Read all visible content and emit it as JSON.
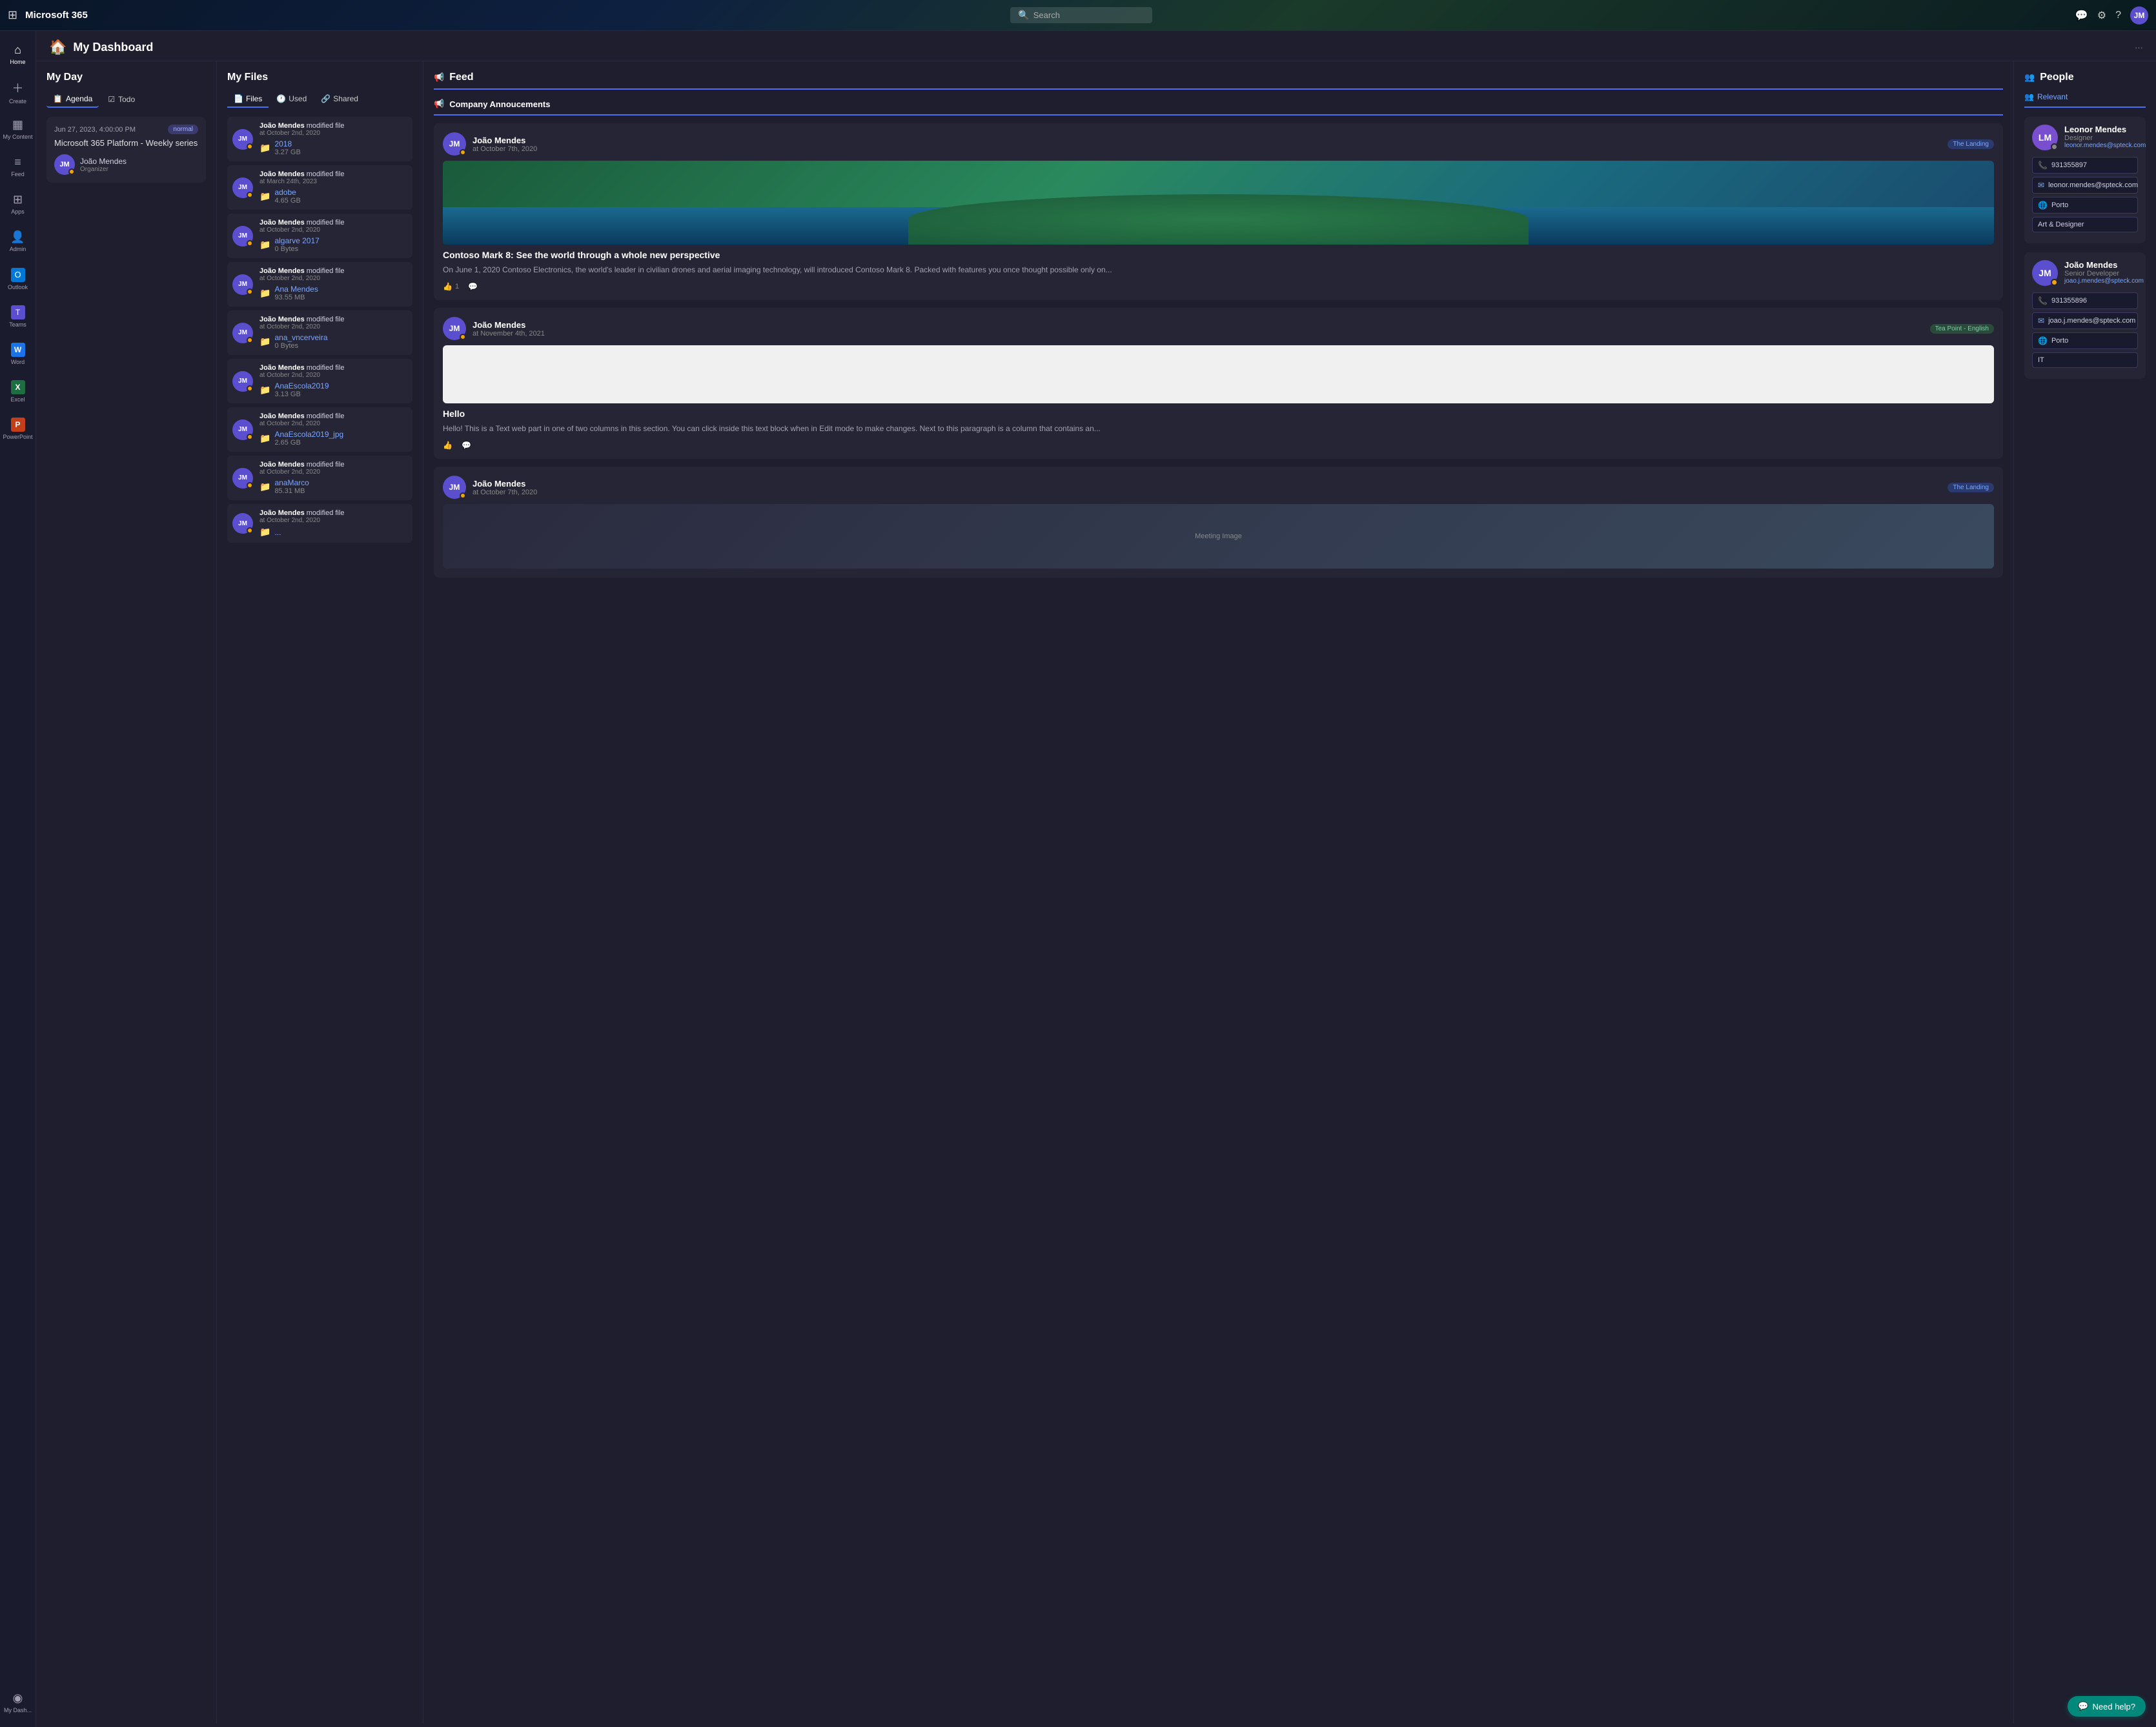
{
  "topbar": {
    "waffle_icon": "⊞",
    "brand": "Microsoft 365",
    "search_placeholder": "Search",
    "search_icon": "🔍"
  },
  "sidebar": {
    "items": [
      {
        "id": "home",
        "icon": "⌂",
        "label": "Home"
      },
      {
        "id": "create",
        "icon": "+",
        "label": "Create"
      },
      {
        "id": "my-content",
        "icon": "▦",
        "label": "My Content"
      },
      {
        "id": "feed",
        "icon": "≡",
        "label": "Feed"
      },
      {
        "id": "apps",
        "icon": "⊞",
        "label": "Apps"
      },
      {
        "id": "admin",
        "icon": "👤",
        "label": "Admin"
      },
      {
        "id": "outlook",
        "icon": "✉",
        "label": "Outlook"
      },
      {
        "id": "teams",
        "icon": "T",
        "label": "Teams"
      },
      {
        "id": "word",
        "icon": "W",
        "label": "Word"
      },
      {
        "id": "excel",
        "icon": "X",
        "label": "Excel"
      },
      {
        "id": "powerpoint",
        "icon": "P",
        "label": "PowerPoint"
      },
      {
        "id": "dashboard",
        "icon": "◉",
        "label": "My Dash..."
      }
    ]
  },
  "page": {
    "icon": "🏠",
    "title": "My Dashboard",
    "more_icon": "···"
  },
  "myday": {
    "title": "My Day",
    "tabs": [
      {
        "id": "agenda",
        "label": "Agenda",
        "icon": "📋",
        "active": true
      },
      {
        "id": "todo",
        "label": "Todo",
        "icon": "☑",
        "active": false
      }
    ],
    "event": {
      "date_time": "Jun 27, 2023, 4:00:00 PM",
      "badge": "normal",
      "title": "Microsoft 365 Platform - Weekly series",
      "organizer_name": "João Mendes",
      "organizer_role": "Organizer"
    }
  },
  "myfiles": {
    "title": "My Files",
    "tabs": [
      {
        "id": "files",
        "label": "Files",
        "icon": "📄",
        "active": true
      },
      {
        "id": "used",
        "label": "Used",
        "icon": "🕐",
        "active": false
      },
      {
        "id": "shared",
        "label": "Shared",
        "icon": "🔗",
        "active": false
      }
    ],
    "items": [
      {
        "person": "João Mendes",
        "action": "modified file",
        "date": "at October 2nd, 2020",
        "folder_name": "2018",
        "folder_size": "3.27 GB",
        "folder_color": "#f0c040"
      },
      {
        "person": "João Mendes",
        "action": "modified file",
        "date": "at March 24th, 2023",
        "folder_name": "adobe",
        "folder_size": "4.65 GB",
        "folder_color": "#f0c040"
      },
      {
        "person": "João Mendes",
        "action": "modified file",
        "date": "at October 2nd, 2020",
        "folder_name": "algarve 2017",
        "folder_size": "0 Bytes",
        "folder_color": "#f0c040"
      },
      {
        "person": "João Mendes",
        "action": "modified file",
        "date": "at October 2nd, 2020",
        "folder_name": "Ana Mendes",
        "folder_size": "93.55 MB",
        "folder_color": "#f0c040"
      },
      {
        "person": "João Mendes",
        "action": "modified file",
        "date": "at October 2nd, 2020",
        "folder_name": "ana_vncerveira",
        "folder_size": "0 Bytes",
        "folder_color": "#f0c040"
      },
      {
        "person": "João Mendes",
        "action": "modified file",
        "date": "at October 2nd, 2020",
        "folder_name": "AnaEscola2019",
        "folder_size": "3.13 GB",
        "folder_color": "#f0c040"
      },
      {
        "person": "João Mendes",
        "action": "modified file",
        "date": "at October 2nd, 2020",
        "folder_name": "AnaEscola2019_jpg",
        "folder_size": "2.65 GB",
        "folder_color": "#f0c040"
      },
      {
        "person": "João Mendes",
        "action": "modified file",
        "date": "at October 2nd, 2020",
        "folder_name": "anaMarco",
        "folder_size": "85.31 MB",
        "folder_color": "#f0c040"
      },
      {
        "person": "João Mendes",
        "action": "modified file",
        "date": "at October 2nd, 2020",
        "folder_name": "...",
        "folder_size": "",
        "folder_color": "#f0c040"
      }
    ]
  },
  "feed": {
    "title": "Feed",
    "tab": "Company Annoucements",
    "posts": [
      {
        "person": "João Mendes",
        "time": "at October 7th, 2020",
        "tag": "The Landing",
        "tag_type": "landing",
        "has_image": true,
        "post_title": "Contoso Mark 8: See the world through a whole new perspective",
        "post_text": "On June 1, 2020 Contoso Electronics, the world's leader in civilian drones and aerial imaging technology, will introduced Contoso Mark 8. Packed with features you once thought possible only on...",
        "likes": 1,
        "has_comment": true
      },
      {
        "person": "João Mendes",
        "time": "at November 4th, 2021",
        "tag": "Tea Point - English",
        "tag_type": "tea",
        "has_image": false,
        "has_white_block": true,
        "post_title": "Hello",
        "post_text": "Hello! This is a Text web part in one of two columns in this section. You can click inside this text block when in Edit mode to make changes. Next to this paragraph is a column that contains an...",
        "likes": 0,
        "has_comment": true
      },
      {
        "person": "João Mendes",
        "time": "at October 7th, 2020",
        "tag": "The Landing",
        "tag_type": "landing",
        "has_meeting_img": true,
        "post_title": "",
        "post_text": "",
        "likes": 0,
        "has_comment": false
      }
    ]
  },
  "people": {
    "title": "People",
    "tab": "Relevant",
    "persons": [
      {
        "name": "Leonor Mendes",
        "role": "Designer",
        "email_display": "leonor.mendes@spteck.com",
        "phone": "931355897",
        "email": "leonor.mendes@spteck.com",
        "location": "Porto",
        "dept": "Art & Designer",
        "avatar_color": "#7a4fcf",
        "avatar_initials": "LM",
        "status_color": "#888"
      },
      {
        "name": "João Mendes",
        "role": "Senior Developer",
        "email_display": "joao.j.mendes@spteck.com",
        "phone": "931355896",
        "email": "joao.j.mendes@spteck.com",
        "location": "Porto",
        "dept": "IT",
        "avatar_color": "#5b4fcf",
        "avatar_initials": "JM",
        "status_color": "#f0a500"
      }
    ]
  },
  "need_help_label": "Need help?"
}
